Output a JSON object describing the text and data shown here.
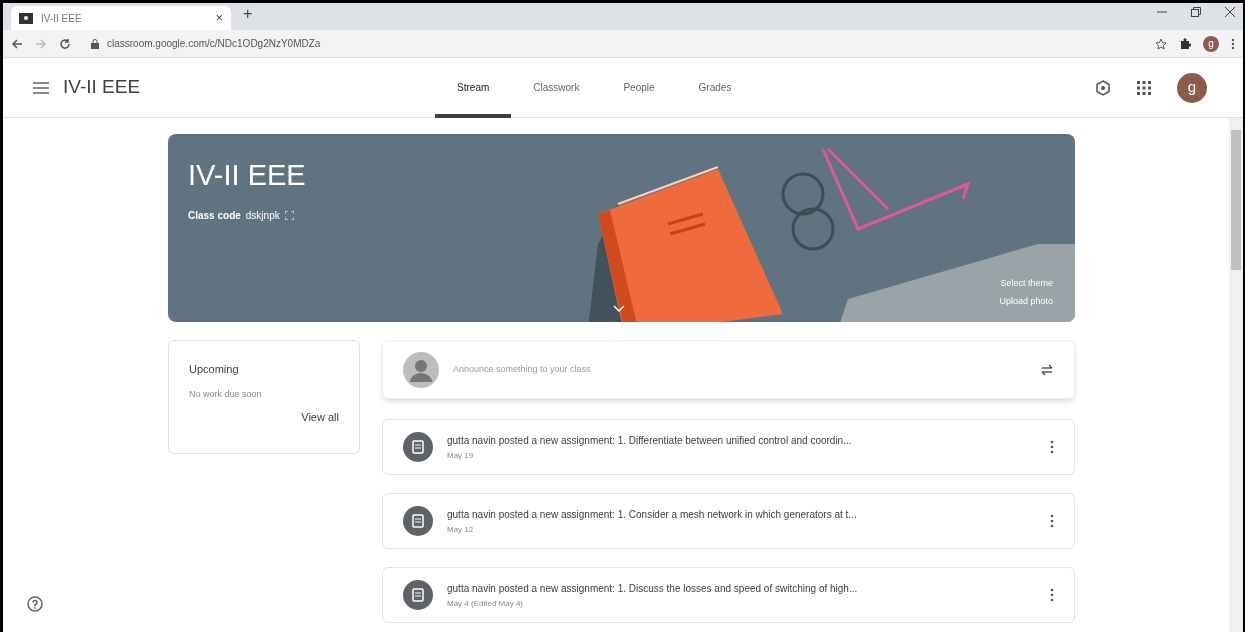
{
  "browser": {
    "tab_title": "IV-II EEE",
    "tab_close": "×",
    "new_tab": "+",
    "url": "classroom.google.com/c/NDc1ODg2NzY0MDZa",
    "profile_initial": "g"
  },
  "header": {
    "class_name": "IV-II EEE",
    "avatar_initial": "g"
  },
  "tabs": [
    {
      "label": "Stream",
      "selected": true
    },
    {
      "label": "Classwork",
      "selected": false
    },
    {
      "label": "People",
      "selected": false
    },
    {
      "label": "Grades",
      "selected": false
    }
  ],
  "banner": {
    "title": "IV-II EEE",
    "class_code_label": "Class code",
    "class_code": "dskjnpk",
    "links": [
      "Select theme",
      "Upload photo"
    ]
  },
  "upcoming": {
    "title": "Upcoming",
    "message": "No work due soon",
    "link": "View all"
  },
  "announce": {
    "placeholder": "Announce something to your class"
  },
  "posts": [
    {
      "text": "gutta navin posted a new assignment: 1. Differentiate between unified control and coordin...",
      "date": "May 19"
    },
    {
      "text": "gutta navin posted a new assignment: 1. Consider a mesh network in which generators at t...",
      "date": "May 12"
    },
    {
      "text": "gutta navin posted a new assignment: 1. Discuss the losses and speed of switching of high...",
      "date": "May 4 (Edited May 4)"
    }
  ]
}
